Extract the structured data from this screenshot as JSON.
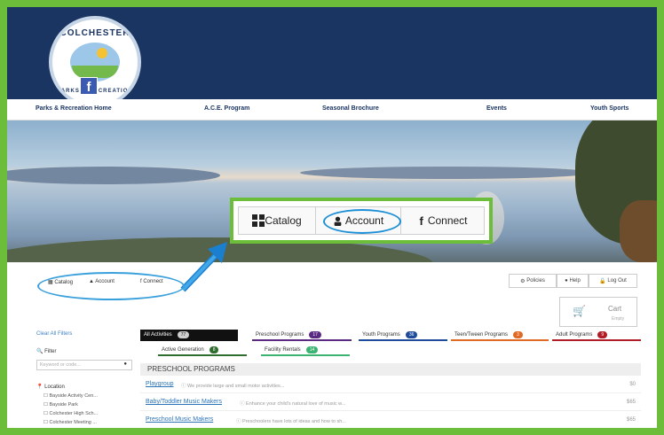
{
  "logo": {
    "text_top": "COLCHESTER",
    "text_bottom": "PARKS & RECREATION"
  },
  "nav": [
    "Parks & Recreation Home",
    "A.C.E. Program",
    "Seasonal Brochure",
    "Events",
    "Youth Sports"
  ],
  "hero_bar": {
    "catalog": "Catalog",
    "account": "Account",
    "connect": "Connect"
  },
  "small_bar": {
    "catalog": "Catalog",
    "account": "Account",
    "connect": "Connect"
  },
  "right_buttons": {
    "policies": "Policies",
    "help": "Help",
    "logout": "Log Out"
  },
  "cart": {
    "label": "Cart",
    "sub": "Empty"
  },
  "sidebar": {
    "clear": "Clear All Filters",
    "filter_label": "Filter",
    "keyword_placeholder": "Keyword or code...",
    "location_label": "Location",
    "locations": [
      "Bayside Activity Cen...",
      "Bayside Park",
      "Colchester High Sch...",
      "Colchester Meeting ..."
    ]
  },
  "tabs_row1": [
    {
      "label": "All Activities",
      "count": "77",
      "color": "#cfcfcf"
    },
    {
      "label": "Preschool Programs",
      "count": "17",
      "color": "#5a2a82"
    },
    {
      "label": "Youth Programs",
      "count": "36",
      "color": "#1f4b9c"
    },
    {
      "label": "Teen/Tween Programs",
      "count": "3",
      "color": "#e06a23"
    },
    {
      "label": "Adult Programs",
      "count": "9",
      "color": "#b11d27"
    }
  ],
  "tabs_row2": [
    {
      "label": "Active Generation",
      "count": "8",
      "color": "#2f6d2f"
    },
    {
      "label": "Facility Rentals",
      "count": "14",
      "color": "#3cb371"
    }
  ],
  "section_header": "PRESCHOOL PROGRAMS",
  "programs": [
    {
      "name": "Playgroup",
      "desc": "We provide large and small motor activities...",
      "price": "$0"
    },
    {
      "name": "Baby/Toddler Music Makers",
      "desc": "Enhance your child's natural love of music w...",
      "price": "$65"
    },
    {
      "name": "Preschool Music Makers",
      "desc": "Preschoolers have lots of ideas and how to sh...",
      "price": "$65"
    }
  ]
}
